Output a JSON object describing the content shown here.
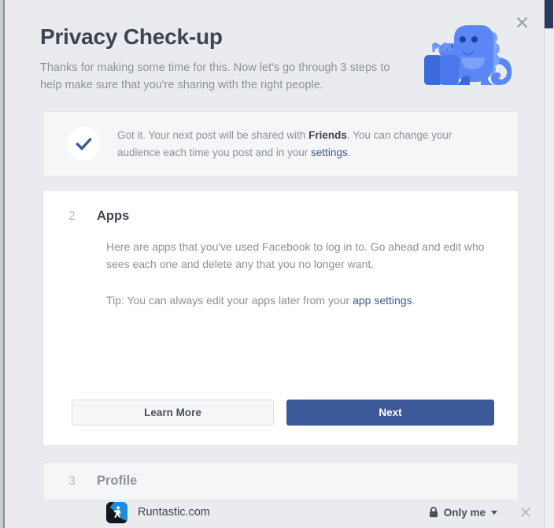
{
  "window": {
    "close_label": "×"
  },
  "header": {
    "title": "Privacy Check-up",
    "subtitle": "Thanks for making some time for this. Now let's go through 3 steps to help make sure that you're sharing with the right people.",
    "mascot": "dinosaur-mascot"
  },
  "banner": {
    "icon": "check-icon",
    "text_before": "Got it. Your next post will be shared with ",
    "audience_bold": "Friends",
    "text_middle": ". You can change your audience each time you post and in your ",
    "settings_link": "settings",
    "text_after": "."
  },
  "apps_step": {
    "number": "2",
    "name": "Apps",
    "description": "Here are apps that you've used Facebook to log in to. Go ahead and edit who sees each one and delete any that you no longer want.",
    "tip_before": "Tip: You can always edit your apps later from your ",
    "tip_link": "app settings",
    "tip_after": ".",
    "apps": [
      {
        "name": "Runtastic.com",
        "icon": "runtastic-app-icon",
        "audience": "Only me",
        "audience_icon": "lock-icon",
        "remove_icon": "close-icon"
      }
    ],
    "learn_more_label": "Learn More",
    "next_label": "Next"
  },
  "profile_step": {
    "number": "3",
    "name": "Profile"
  },
  "colors": {
    "accent": "#3b5998",
    "page_bg": "#e9ebee",
    "card_bg": "#ffffff",
    "muted_text": "#8d919c",
    "dark_text": "#3f4451",
    "mascot_body": "#4a7cf0",
    "mascot_dark": "#3860d8"
  }
}
